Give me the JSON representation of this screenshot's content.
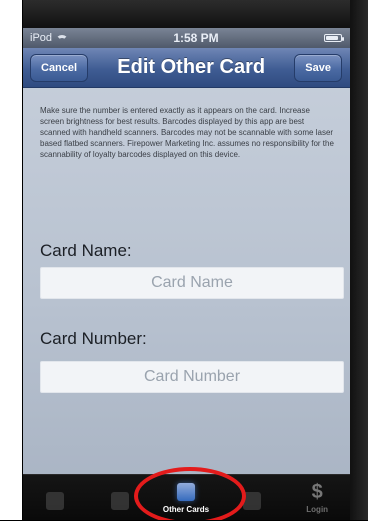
{
  "status_bar": {
    "carrier": "iPod",
    "time": "1:58 PM"
  },
  "nav": {
    "cancel_label": "Cancel",
    "title": "Edit Other Card",
    "save_label": "Save"
  },
  "disclaimer": "Make sure the number is entered exactly as it appears on the card. Increase screen brightness for best results. Barcodes displayed by this app are best scanned with handheld scanners. Barcodes may not be scannable with some laser based flatbed scanners. Firepower Marketing Inc. assumes no responsibility for the scannability of loyalty barcodes displayed on this device.",
  "form": {
    "card_name": {
      "label": "Card Name:",
      "value": "",
      "placeholder": "Card Name"
    },
    "card_number": {
      "label": "Card Number:",
      "value": "",
      "placeholder": "Card Number"
    }
  },
  "tabbar": {
    "tabs": [
      {
        "label": "",
        "icon": "cards-icon",
        "active": false
      },
      {
        "label": "",
        "icon": "user-icon",
        "active": false
      },
      {
        "label": "Other Cards",
        "icon": "folder-icon",
        "active": true
      },
      {
        "label": "",
        "icon": "barcode-icon",
        "active": false
      },
      {
        "label": "Login",
        "icon": "dollar-icon",
        "active": false
      }
    ]
  },
  "colors": {
    "nav_blue": "#3f5c93",
    "screen_bg": "#b8c2d0",
    "tabbar_bg": "#0a0a0a",
    "highlight_red": "#e31b1b"
  }
}
